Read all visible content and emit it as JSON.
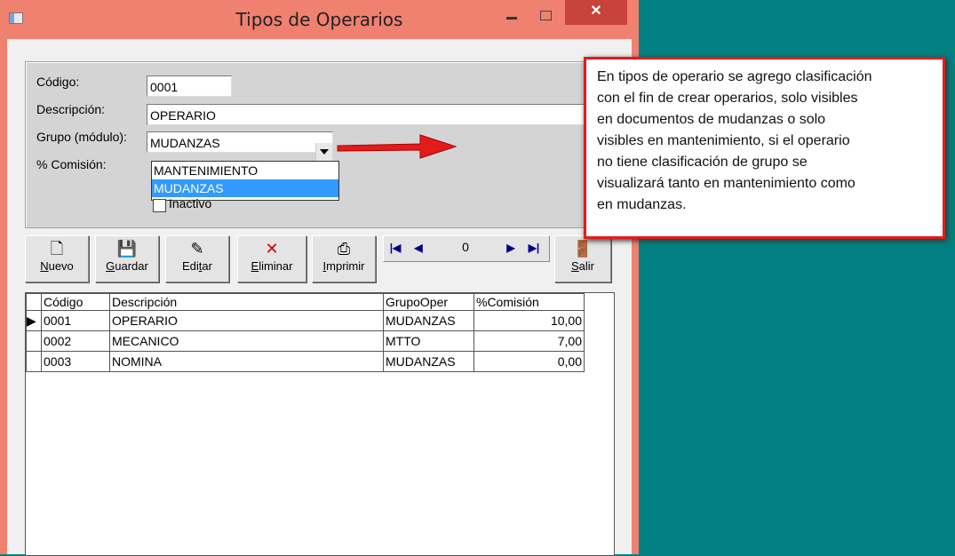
{
  "window": {
    "title": "Tipos de Operarios",
    "close_glyph": "✕"
  },
  "form": {
    "codigo_label": "Código:",
    "codigo_value": "0001",
    "descripcion_label": "Descripción:",
    "descripcion_value": "OPERARIO",
    "grupo_label": "Grupo (módulo):",
    "grupo_value": "MUDANZAS",
    "grupo_options": [
      "MANTENIMIENTO",
      "MUDANZAS"
    ],
    "comision_label": "% Comisión:",
    "inactivo_label": "Inactivo"
  },
  "toolbar": {
    "nuevo": {
      "u": "N",
      "rest": "uevo",
      "icon": "new-doc-icon"
    },
    "guardar": {
      "u": "G",
      "rest": "uardar",
      "icon": "save-icon"
    },
    "editar": {
      "pre": "Edi",
      "u": "t",
      "rest": "ar",
      "icon": "edit-icon"
    },
    "eliminar": {
      "u": "E",
      "rest": "liminar",
      "icon": "delete-icon"
    },
    "imprimir": {
      "u": "I",
      "rest": "mprimir",
      "icon": "print-icon"
    },
    "salir": {
      "u": "S",
      "rest": "alir",
      "icon": "exit-icon"
    },
    "nav_count": "0"
  },
  "grid": {
    "columns": [
      "Código",
      "Descripción",
      "GrupoOper",
      "%Comisión"
    ],
    "rows": [
      [
        "0001",
        "OPERARIO",
        "MUDANZAS",
        "10,00"
      ],
      [
        "0002",
        "MECANICO",
        "MTTO",
        "7,00"
      ],
      [
        "0003",
        "NOMINA",
        "MUDANZAS",
        "0,00"
      ]
    ]
  },
  "annotation": {
    "lines": [
      "En tipos de operario se agrego clasificación",
      "con el fin de crear operarios, solo visibles",
      "en documentos de mudanzas o solo",
      "visibles en mantenimiento, si el operario",
      "no tiene clasificación de grupo se",
      "visualizará tanto en mantenimiento como",
      "en mudanzas."
    ]
  },
  "colors": {
    "title_bar": "#f08070",
    "desktop": "#008080",
    "callout_border": "#e31b1b",
    "selection": "#3399ff"
  }
}
